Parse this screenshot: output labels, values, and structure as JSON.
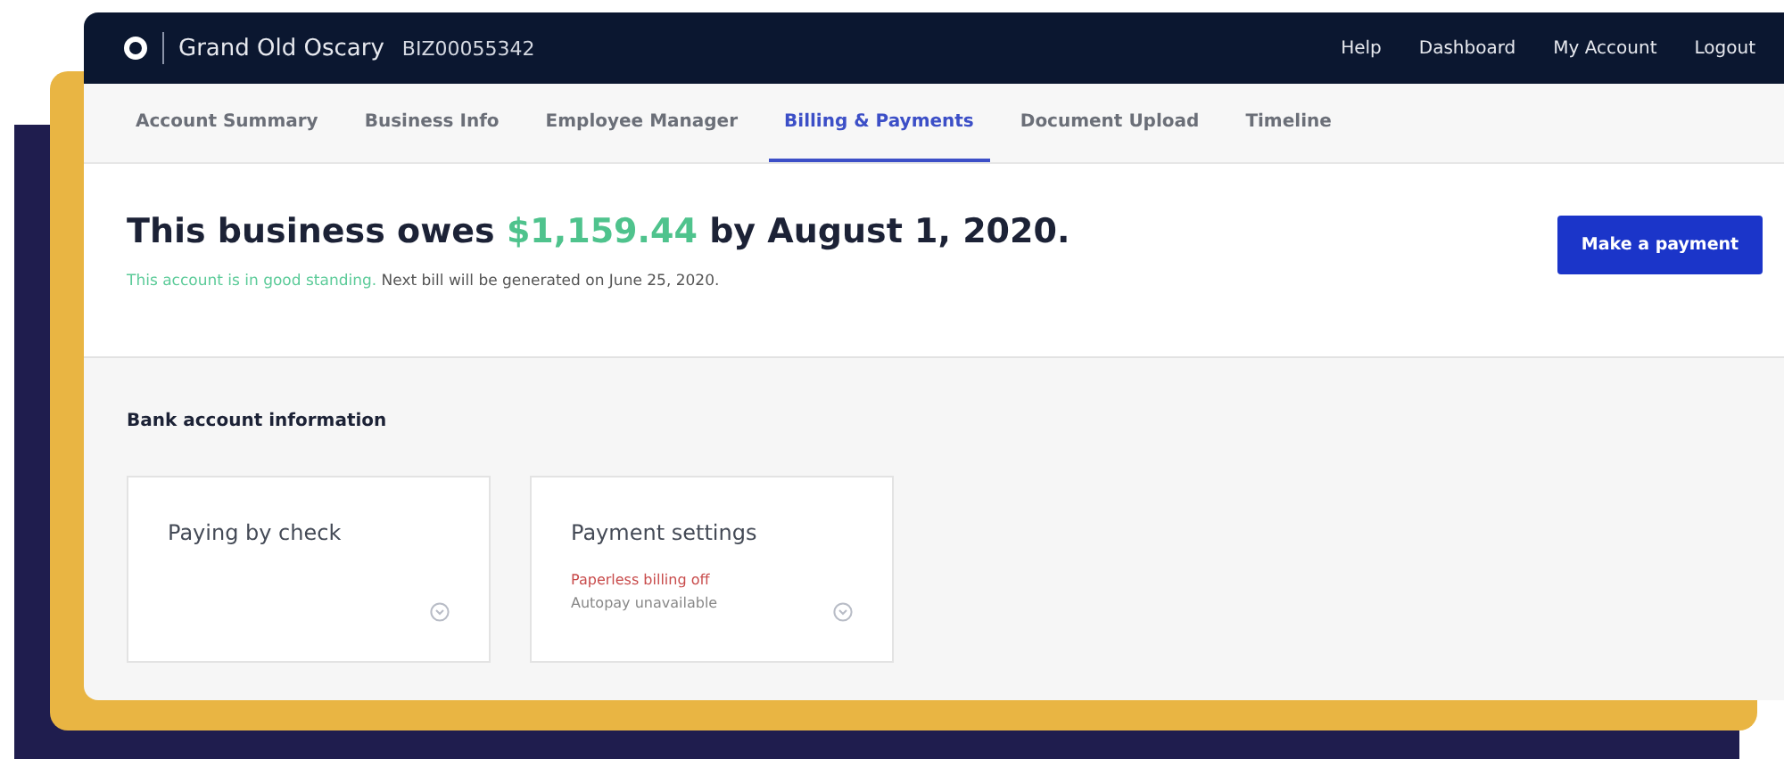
{
  "header": {
    "brand": "Grand Old Oscary",
    "account_id": "BIZ00055342",
    "links": [
      "Help",
      "Dashboard",
      "My Account",
      "Logout"
    ]
  },
  "tabs": [
    {
      "label": "Account Summary",
      "selected": false
    },
    {
      "label": "Business Info",
      "selected": false
    },
    {
      "label": "Employee Manager",
      "selected": false
    },
    {
      "label": "Billing & Payments",
      "selected": true
    },
    {
      "label": "Document Upload",
      "selected": false
    },
    {
      "label": "Timeline",
      "selected": false
    }
  ],
  "summary": {
    "lead": "This business owes",
    "amount": "$1,159.44",
    "trail": "by August 1, 2020.",
    "standing": "This account is in good standing.",
    "next_bill": "Next bill will be generated on June 25, 2020.",
    "button": "Make a payment"
  },
  "bank": {
    "heading": "Bank account information",
    "cards": [
      {
        "title": "Paying by check"
      },
      {
        "title": "Payment settings",
        "lines": [
          {
            "text": "Paperless billing off",
            "kind": "alert"
          },
          {
            "text": "Autopay unavailable",
            "kind": "muted"
          }
        ]
      }
    ]
  }
}
